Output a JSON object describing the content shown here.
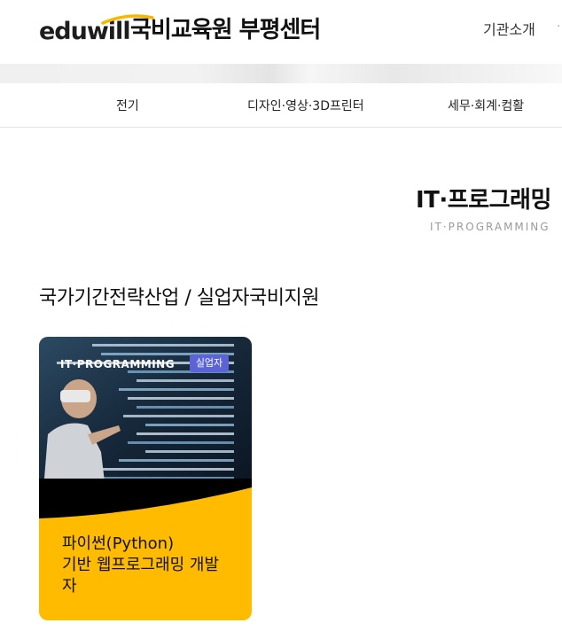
{
  "header": {
    "logo_text": "eduwill",
    "center_name": "국비교육원 부평센터",
    "nav_item": "기관소개",
    "more": "·"
  },
  "categories": [
    "전기",
    "디자인·영상·3D프린터",
    "세무·회계·컴활"
  ],
  "page": {
    "title": "IT·프로그래밍",
    "subtitle": "IT·PROGRAMMING",
    "section": "국가기간전략산업 / 실업자국비지원"
  },
  "courses": [
    {
      "tag": "IT·PROGRAMMING",
      "badge": "실업자",
      "title_line1": "파이썬(Python)",
      "title_line2": "기반 웹프로그래밍 개발",
      "title_line3": "자"
    }
  ],
  "colors": {
    "card_accent": "#ffbb00",
    "badge": "#5b63d6",
    "logo_swoosh": "#f5b800"
  }
}
